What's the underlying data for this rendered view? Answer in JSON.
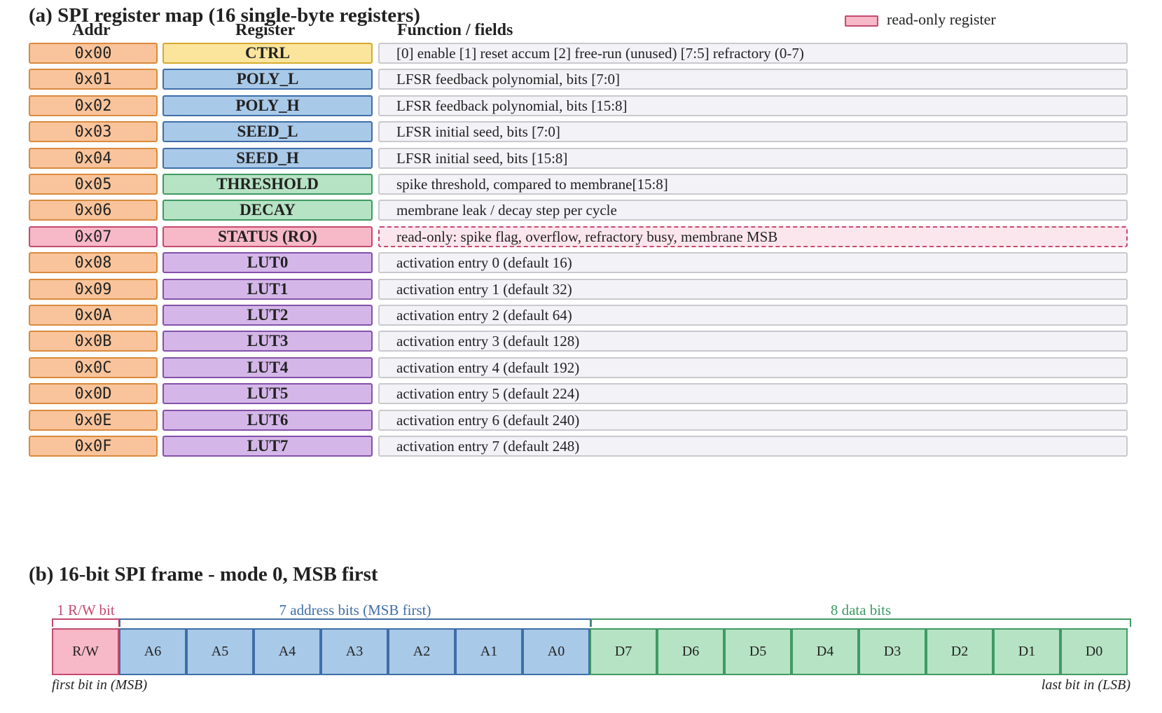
{
  "section_a": {
    "title": "(a)  SPI register map (16 single-byte registers)",
    "col_addr": "Addr",
    "col_register": "Register",
    "col_function": "Function / fields",
    "legend_label": "read-only register",
    "rows": [
      {
        "addr": "0x00",
        "name": "CTRL",
        "group": "ctrl",
        "desc": "[0] enable   [1] reset accum   [2] free-run (unused)   [7:5] refractory (0-7)",
        "ro": false
      },
      {
        "addr": "0x01",
        "name": "POLY_L",
        "group": "lfsr",
        "desc": "LFSR feedback polynomial, bits [7:0]",
        "ro": false
      },
      {
        "addr": "0x02",
        "name": "POLY_H",
        "group": "lfsr",
        "desc": "LFSR feedback polynomial, bits [15:8]",
        "ro": false
      },
      {
        "addr": "0x03",
        "name": "SEED_L",
        "group": "lfsr",
        "desc": "LFSR initial seed, bits [7:0]",
        "ro": false
      },
      {
        "addr": "0x04",
        "name": "SEED_H",
        "group": "lfsr",
        "desc": "LFSR initial seed, bits [15:8]",
        "ro": false
      },
      {
        "addr": "0x05",
        "name": "THRESHOLD",
        "group": "neuron",
        "desc": "spike threshold, compared to membrane[15:8]",
        "ro": false
      },
      {
        "addr": "0x06",
        "name": "DECAY",
        "group": "neuron",
        "desc": "membrane leak / decay step per cycle",
        "ro": false
      },
      {
        "addr": "0x07",
        "name": "STATUS  (RO)",
        "group": "status",
        "desc": "read-only: spike flag, overflow, refractory busy, membrane MSB",
        "ro": true
      },
      {
        "addr": "0x08",
        "name": "LUT0",
        "group": "lut",
        "desc": "activation entry 0   (default 16)",
        "ro": false
      },
      {
        "addr": "0x09",
        "name": "LUT1",
        "group": "lut",
        "desc": "activation entry 1   (default 32)",
        "ro": false
      },
      {
        "addr": "0x0A",
        "name": "LUT2",
        "group": "lut",
        "desc": "activation entry 2   (default 64)",
        "ro": false
      },
      {
        "addr": "0x0B",
        "name": "LUT3",
        "group": "lut",
        "desc": "activation entry 3   (default 128)",
        "ro": false
      },
      {
        "addr": "0x0C",
        "name": "LUT4",
        "group": "lut",
        "desc": "activation entry 4   (default 192)",
        "ro": false
      },
      {
        "addr": "0x0D",
        "name": "LUT5",
        "group": "lut",
        "desc": "activation entry 5   (default 224)",
        "ro": false
      },
      {
        "addr": "0x0E",
        "name": "LUT6",
        "group": "lut",
        "desc": "activation entry 6   (default 240)",
        "ro": false
      },
      {
        "addr": "0x0F",
        "name": "LUT7",
        "group": "lut",
        "desc": "activation entry 7   (default 248)",
        "ro": false
      }
    ]
  },
  "section_b": {
    "title": "(b)  16-bit SPI frame  -  mode 0, MSB first",
    "rw_label": "1 R/W bit",
    "addr_label": "7 address bits (MSB first)",
    "data_label": "8 data bits",
    "first_note": "first bit in (MSB)",
    "last_note": "last bit in (LSB)",
    "bits": [
      {
        "label": "R/W",
        "kind": "rw"
      },
      {
        "label": "A6",
        "kind": "ad"
      },
      {
        "label": "A5",
        "kind": "ad"
      },
      {
        "label": "A4",
        "kind": "ad"
      },
      {
        "label": "A3",
        "kind": "ad"
      },
      {
        "label": "A2",
        "kind": "ad"
      },
      {
        "label": "A1",
        "kind": "ad"
      },
      {
        "label": "A0",
        "kind": "ad"
      },
      {
        "label": "D7",
        "kind": "da"
      },
      {
        "label": "D6",
        "kind": "da"
      },
      {
        "label": "D5",
        "kind": "da"
      },
      {
        "label": "D4",
        "kind": "da"
      },
      {
        "label": "D3",
        "kind": "da"
      },
      {
        "label": "D2",
        "kind": "da"
      },
      {
        "label": "D1",
        "kind": "da"
      },
      {
        "label": "D0",
        "kind": "da"
      }
    ]
  },
  "colors": {
    "addr_fill": "#f9c49b",
    "ctrl_fill": "#fbe59d",
    "lfsr_fill": "#a9c9e8",
    "neuron_fill": "#b6e3c4",
    "status_fill": "#f7b8c8",
    "lut_fill": "#d4b7e8",
    "rw_text": "#c44a6e",
    "addr_text": "#3f6ea8",
    "data_text": "#3f9a63"
  }
}
